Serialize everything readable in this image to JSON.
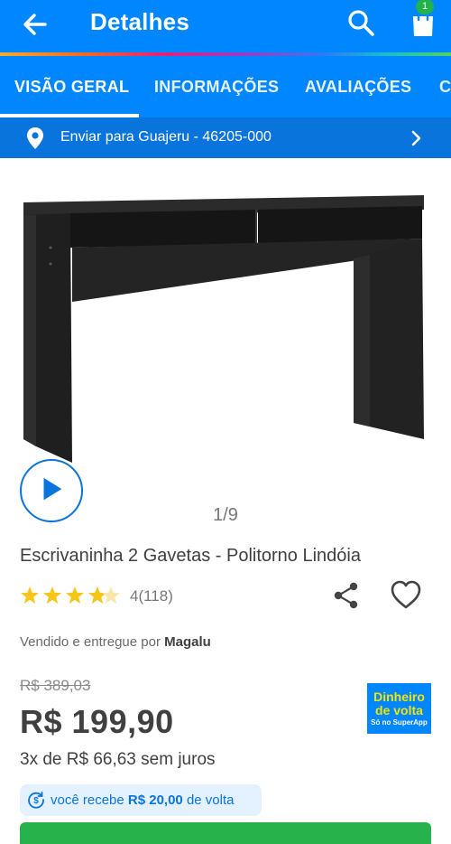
{
  "header": {
    "title": "Detalhes",
    "cart_count": "1"
  },
  "tabs": [
    {
      "label": "VISÃO GERAL",
      "active": true
    },
    {
      "label": "INFORMAÇÕES",
      "active": false
    },
    {
      "label": "AVALIAÇÕES",
      "active": false
    },
    {
      "label": "C",
      "active": false
    }
  ],
  "shipping": {
    "text": "Enviar para Guajeru - 46205-000"
  },
  "gallery": {
    "pager": "1/9"
  },
  "product": {
    "name": "Escrivaninha 2 Gavetas - Politorno Lindóia",
    "rating_value": 4,
    "rating_text": "4(118)",
    "seller_prefix": "Vendido e entregue por ",
    "seller_name": "Magalu",
    "old_price": "R$ 389,03",
    "price": "R$ 199,90",
    "installments": "3x de R$ 66,63 sem juros"
  },
  "cashback": {
    "badge_line1": "Dinheiro",
    "badge_line2": "de volta",
    "badge_line3": "Só no SuperApp",
    "prefix": "você recebe ",
    "amount": "R$ 20,00",
    "suffix": " de volta"
  },
  "colors": {
    "primary": "#0086ff",
    "shipbar": "#0a74dd",
    "star": "#f5c518",
    "buy_button": "#28b24c"
  },
  "icons": {
    "back": "arrow-left",
    "search": "magnifier",
    "cart": "shopping-bag",
    "location": "map-pin",
    "chevron": "chevron-right",
    "play": "play",
    "share": "share-nodes",
    "favorite": "heart-outline",
    "cashback": "cashback-coin"
  }
}
